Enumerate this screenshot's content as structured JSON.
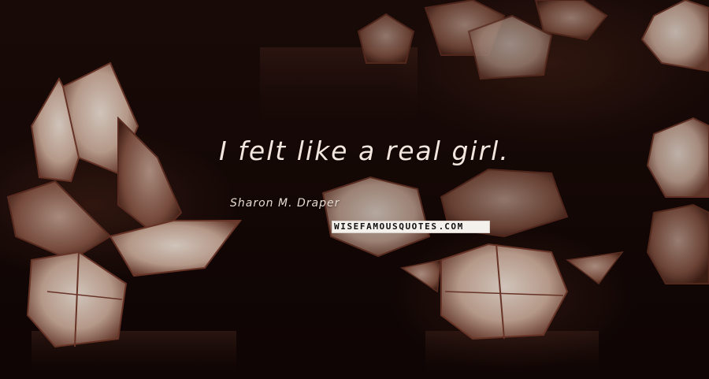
{
  "quote": {
    "text": "I felt like a real girl.",
    "author": "Sharon M. Draper"
  },
  "watermark": {
    "main": "WISEFAMOUSQUOTES",
    "dot": ".",
    "suffix": "COM"
  },
  "background": {
    "description_icon": "floating-lotus-lanterns-image",
    "colors": {
      "dark": "#120806",
      "lantern_light": "#f3e3d6",
      "lantern_edge": "#8a4a3a",
      "quote_text": "#f2e6de"
    }
  }
}
